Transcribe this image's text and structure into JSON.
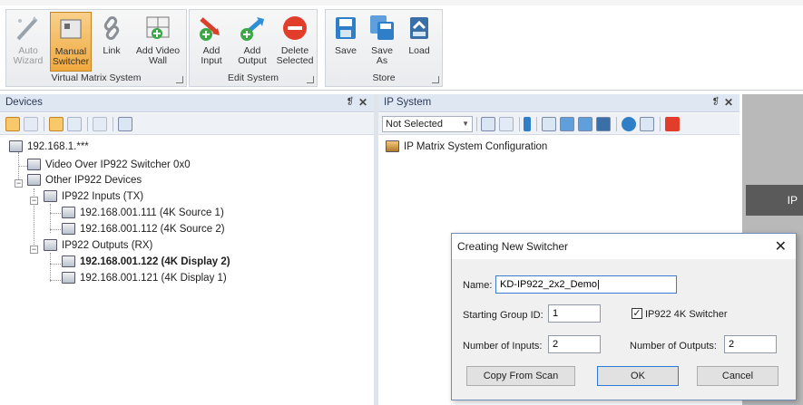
{
  "ribbon": {
    "groups": [
      {
        "label": "Virtual Matrix System"
      },
      {
        "label": "Edit System"
      },
      {
        "label": "Store"
      }
    ],
    "buttons": {
      "auto_wizard": [
        "Auto",
        "Wizard"
      ],
      "manual_switcher": [
        "Manual",
        "Switcher"
      ],
      "link": [
        "Link",
        ""
      ],
      "add_video_wall": [
        "Add Video",
        "Wall"
      ],
      "add_input": [
        "Add",
        "Input"
      ],
      "add_output": [
        "Add",
        "Output"
      ],
      "delete_selected": [
        "Delete",
        "Selected"
      ],
      "save": [
        "Save",
        ""
      ],
      "save_as": [
        "Save",
        "As"
      ],
      "load": [
        "Load",
        ""
      ]
    }
  },
  "devices_panel": {
    "title": "Devices",
    "pin": "❡",
    "close": "✕",
    "tree": {
      "root": "192.168.1.***",
      "video_switcher": "Video Over IP922 Switcher 0x0",
      "other_devices": "Other IP922 Devices",
      "inputs_group": "IP922 Inputs (TX)",
      "input_1": "192.168.001.111 (4K Source 1)",
      "input_2": "192.168.001.112 (4K Source 2)",
      "outputs_group": "IP922 Outputs (RX)",
      "output_1": "192.168.001.122 (4K Display 2)",
      "output_2": "192.168.001.121 (4K Display 1)"
    }
  },
  "ip_panel": {
    "title": "IP System",
    "pin": "❡",
    "close": "✕",
    "select_value": "Not Selected",
    "tree_item": "IP Matrix System Configuration"
  },
  "right_bar_text": "IP",
  "dialog": {
    "title": "Creating New Switcher",
    "close": "✕",
    "name_label": "Name:",
    "name_value": "KD-IP922_2x2_Demo|",
    "start_group_label": "Starting Group ID:",
    "start_group_value": "1",
    "switcher_checkbox_label": "IP922 4K Switcher",
    "switcher_checked": "✓",
    "inputs_label": "Number of Inputs:",
    "inputs_value": "2",
    "outputs_label": "Number of Outputs:",
    "outputs_value": "2",
    "copy_button": "Copy From Scan",
    "ok_button": "OK",
    "cancel_button": "Cancel"
  },
  "colors": {
    "active_button": "#f1a93f",
    "panel_title_bg": "#dfe7f3",
    "delete_red": "#e23d2a",
    "add_green": "#39a845"
  }
}
